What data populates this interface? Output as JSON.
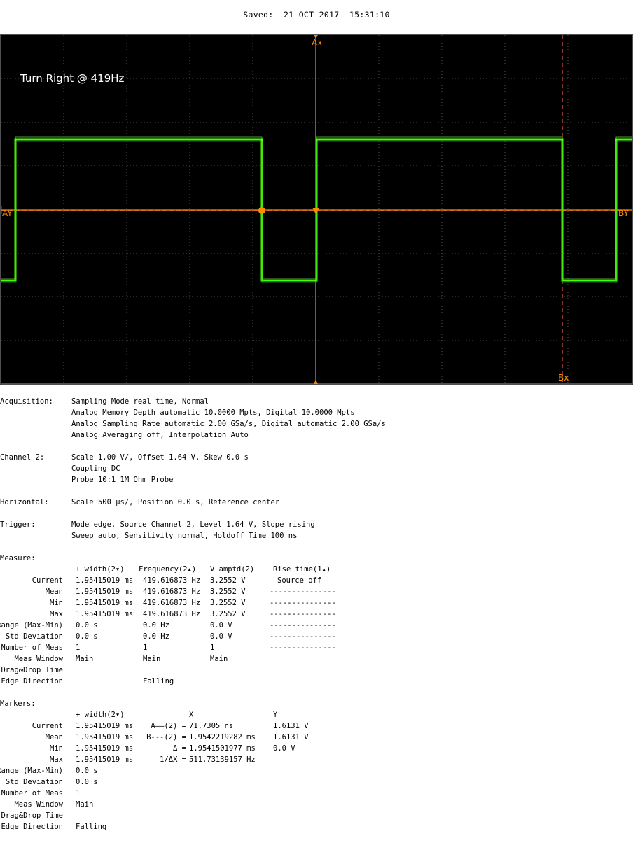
{
  "saved": "Saved:  21 OCT 2017  15:31:10",
  "screen": {
    "annotation": "Turn Right @ 419Hz",
    "marker_ax": "Ax",
    "marker_ay": "AY",
    "marker_bx": "Bx",
    "marker_by": "BY",
    "colors": {
      "trace": "#44ff00",
      "marker_a": "#ff8c00",
      "marker_b": "#e05a4a",
      "grid": "#5a5a5a",
      "background": "#000000"
    }
  },
  "acquisition": {
    "label": "Acquisition:",
    "lines": [
      "Sampling Mode real time, Normal",
      "Analog Memory Depth automatic 10.0000 Mpts, Digital 10.0000 Mpts",
      "Analog Sampling Rate automatic 2.00 GSa/s, Digital automatic 2.00 GSa/s",
      "Analog Averaging off, Interpolation Auto"
    ]
  },
  "channel2": {
    "label": "Channel 2:",
    "lines": [
      "Scale 1.00 V/, Offset 1.64 V, Skew 0.0 s",
      "Coupling DC",
      "Probe 10:1 1M Ohm Probe"
    ]
  },
  "horizontal": {
    "label": "Horizontal:",
    "lines": [
      "Scale 500 µs/, Position 0.0 s, Reference center"
    ]
  },
  "trigger": {
    "label": "Trigger:",
    "lines": [
      "Mode edge, Source Channel 2, Level 1.64 V, Slope rising",
      "Sweep auto, Sensitivity normal, Holdoff Time 100 ns"
    ]
  },
  "measure": {
    "label": "Measure:",
    "headers": [
      "+ width(2▾)",
      "Frequency(2▴)",
      "V amptd(2)",
      "Rise time(1▴)"
    ],
    "rows": [
      {
        "label": "Current",
        "c1": "1.95415019 ms",
        "c2": "419.616873 Hz",
        "c3": "3.2552 V",
        "c4": "Source off"
      },
      {
        "label": "Mean",
        "c1": "1.95415019 ms",
        "c2": "419.616873 Hz",
        "c3": "3.2552 V",
        "c4": "---------------"
      },
      {
        "label": "Min",
        "c1": "1.95415019 ms",
        "c2": "419.616873 Hz",
        "c3": "3.2552 V",
        "c4": "---------------"
      },
      {
        "label": "Max",
        "c1": "1.95415019 ms",
        "c2": "419.616873 Hz",
        "c3": "3.2552 V",
        "c4": "---------------"
      },
      {
        "label": "Range (Max-Min)",
        "c1": "0.0 s",
        "c2": "0.0 Hz",
        "c3": "0.0 V",
        "c4": "---------------"
      },
      {
        "label": "Std Deviation",
        "c1": "0.0 s",
        "c2": "0.0 Hz",
        "c3": "0.0 V",
        "c4": "---------------"
      },
      {
        "label": "Number of Meas",
        "c1": "1",
        "c2": "1",
        "c3": "1",
        "c4": "---------------"
      },
      {
        "label": "Meas Window",
        "c1": "Main",
        "c2": "Main",
        "c3": "Main",
        "c4": ""
      },
      {
        "label": "Drag&Drop Time",
        "c1": "",
        "c2": "",
        "c3": "",
        "c4": ""
      },
      {
        "label": "Edge Direction",
        "c1": "",
        "c2": "Falling",
        "c3": "",
        "c4": ""
      }
    ]
  },
  "markers": {
    "label": "Markers:",
    "headers": [
      "+ width(2▾)",
      "X",
      "Y"
    ],
    "rows": [
      {
        "label": "Current",
        "c1": "1.95415019 ms",
        "m": "A——(2) =",
        "x": "71.7305 ns",
        "y": "1.6131 V"
      },
      {
        "label": "Mean",
        "c1": "1.95415019 ms",
        "m": "B---(2) =",
        "x": "1.9542219282 ms",
        "y": "1.6131 V"
      },
      {
        "label": "Min",
        "c1": "1.95415019 ms",
        "m": "Δ =",
        "x": "1.9541501977 ms",
        "y": "0.0 V"
      },
      {
        "label": "Max",
        "c1": "1.95415019 ms",
        "m": "1/ΔX =",
        "x": "511.73139157 Hz",
        "y": ""
      },
      {
        "label": "Range (Max-Min)",
        "c1": "0.0 s",
        "m": "",
        "x": "",
        "y": ""
      },
      {
        "label": "Std Deviation",
        "c1": "0.0 s",
        "m": "",
        "x": "",
        "y": ""
      },
      {
        "label": "Number of Meas",
        "c1": "1",
        "m": "",
        "x": "",
        "y": ""
      },
      {
        "label": "Meas Window",
        "c1": "Main",
        "m": "",
        "x": "",
        "y": ""
      },
      {
        "label": "Drag&Drop Time",
        "c1": "",
        "m": "",
        "x": "",
        "y": ""
      },
      {
        "label": "Edge Direction",
        "c1": "Falling",
        "m": "",
        "x": "",
        "y": ""
      }
    ]
  }
}
